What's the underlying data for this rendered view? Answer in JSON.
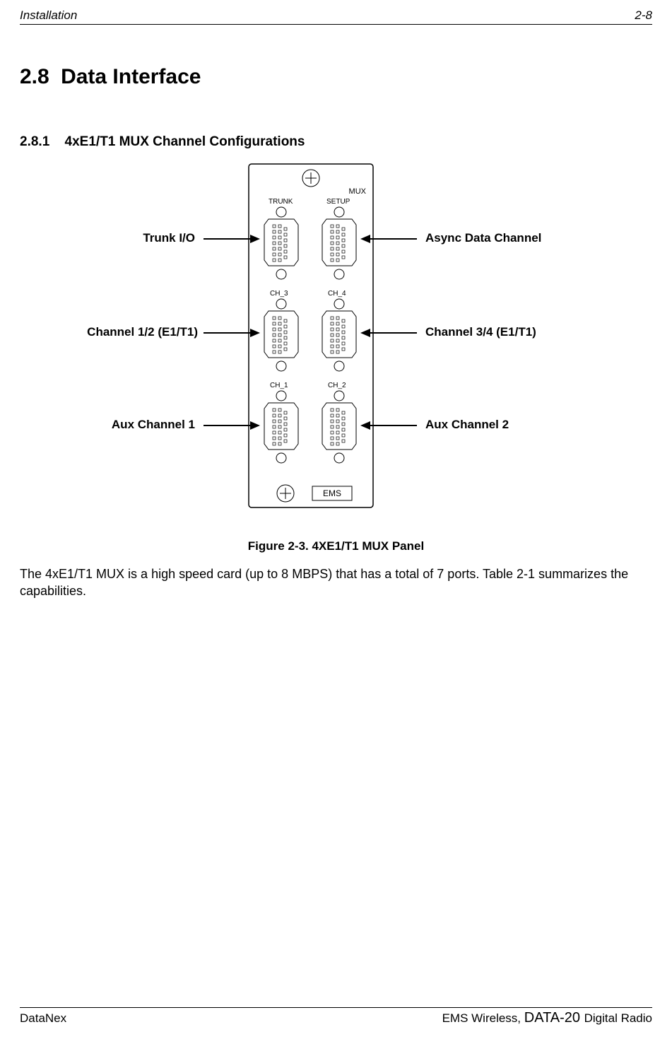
{
  "header": {
    "left": "Installation",
    "right": "2-8"
  },
  "section": {
    "num": "2.8",
    "title": "Data Interface"
  },
  "subsection": {
    "num": "2.8.1",
    "title": "4xE1/T1 MUX Channel Configurations"
  },
  "panel": {
    "top_right_label": "MUX",
    "port_labels": {
      "tl": "TRUNK",
      "tr": "SETUP",
      "ml": "CH_3",
      "mr": "CH_4",
      "bl": "CH_1",
      "br": "CH_2"
    },
    "ems": "EMS"
  },
  "callouts": {
    "trunk": "Trunk I/O",
    "async": "Async Data Channel",
    "ch12": "Channel 1/2 (E1/T1)",
    "ch34": "Channel 3/4 (E1/T1)",
    "aux1": "Aux Channel 1",
    "aux2": "Aux Channel 2"
  },
  "figure_caption": "Figure 2-3.  4XE1/T1 MUX Panel",
  "body": "The 4xE1/T1 MUX is a high speed card (up to 8 MBPS) that has a total of 7 ports.  Table 2-1 summarizes the capabilities.",
  "footer": {
    "left": "DataNex",
    "right_prefix": "EMS Wireless, ",
    "right_big": "DATA-20 ",
    "right_suffix": "Digital Radio"
  }
}
